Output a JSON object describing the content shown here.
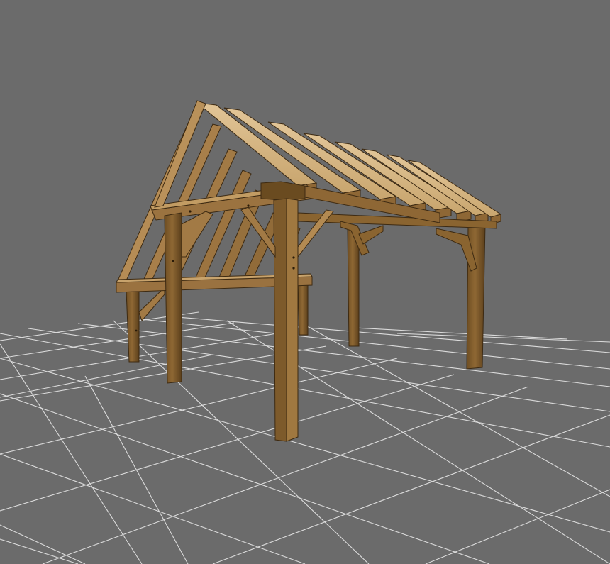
{
  "viewport": {
    "background_color": "#6b6b6b",
    "grid_color": "#e2e2e2",
    "timber_colors": {
      "base": "#8a6430",
      "light": "#b9915a",
      "pale": "#d8b98a",
      "dark": "#5a3f1c",
      "shadow": "#3d2a12"
    },
    "scene_object": "timber-frame-pavilion"
  }
}
